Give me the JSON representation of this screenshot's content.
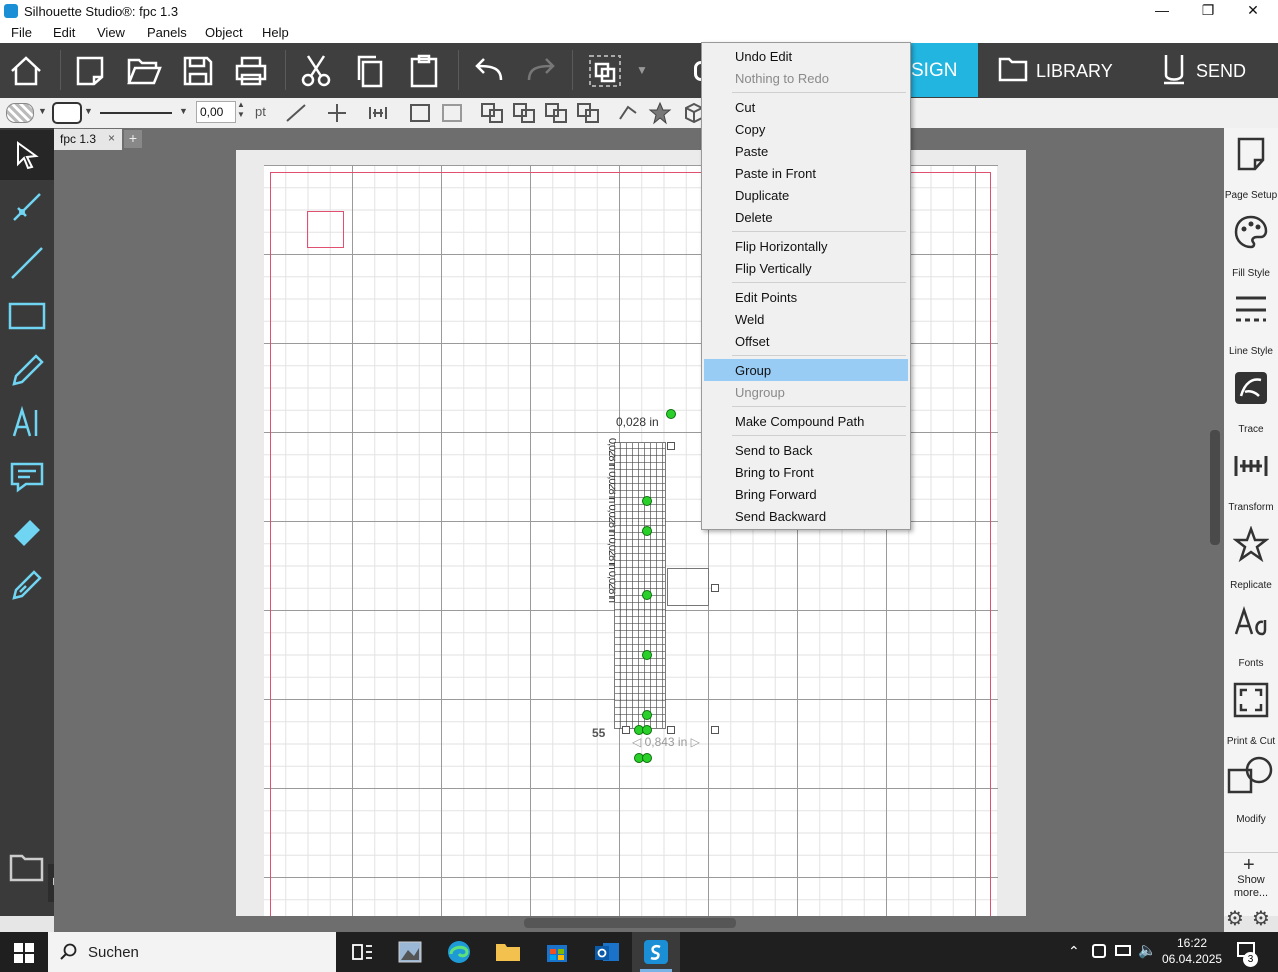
{
  "window": {
    "title": "Silhouette Studio®: fpc 1.3"
  },
  "menubar": [
    "File",
    "Edit",
    "View",
    "Panels",
    "Object",
    "Help"
  ],
  "tabs": {
    "design": "SIGN",
    "library": "LIBRARY",
    "send": "SEND"
  },
  "toolbar2": {
    "line_width": "0,00",
    "line_unit": "pt"
  },
  "document_tab": {
    "name": "fpc 1.3",
    "close": "×",
    "add": "+"
  },
  "context_menu": {
    "items": [
      {
        "label": "Undo Edit",
        "enabled": true
      },
      {
        "label": "Nothing to Redo",
        "enabled": false
      },
      {
        "label": "Cut",
        "enabled": true
      },
      {
        "label": "Copy",
        "enabled": true
      },
      {
        "label": "Paste",
        "enabled": true
      },
      {
        "label": "Paste in Front",
        "enabled": true
      },
      {
        "label": "Duplicate",
        "enabled": true
      },
      {
        "label": "Delete",
        "enabled": true
      },
      {
        "label": "Flip Horizontally",
        "enabled": true
      },
      {
        "label": "Flip Vertically",
        "enabled": true
      },
      {
        "label": "Edit Points",
        "enabled": true
      },
      {
        "label": "Weld",
        "enabled": true
      },
      {
        "label": "Offset",
        "enabled": true
      },
      {
        "label": "Group",
        "enabled": true,
        "highlighted": true
      },
      {
        "label": "Ungroup",
        "enabled": false
      },
      {
        "label": "Make Compound Path",
        "enabled": true
      },
      {
        "label": "Send to Back",
        "enabled": true
      },
      {
        "label": "Bring to Front",
        "enabled": true
      },
      {
        "label": "Bring Forward",
        "enabled": true
      },
      {
        "label": "Send Backward",
        "enabled": true
      }
    ]
  },
  "right_panel": [
    "Page Setup",
    "Fill Style",
    "Line Style",
    "Trace",
    "Transform",
    "Replicate",
    "Fonts",
    "Print & Cut",
    "Modify",
    "Show more..."
  ],
  "canvas": {
    "dimension_width": "0,843 in",
    "dimension_top": "0,028 in",
    "dimension_side": "55"
  },
  "taskbar": {
    "search": "Suchen",
    "time": "16:22",
    "date": "06.04.2025",
    "notifications": "3"
  },
  "colors": {
    "accent": "#22b5e0",
    "highlight": "#99ccf5",
    "cut_line": "#e05070"
  }
}
